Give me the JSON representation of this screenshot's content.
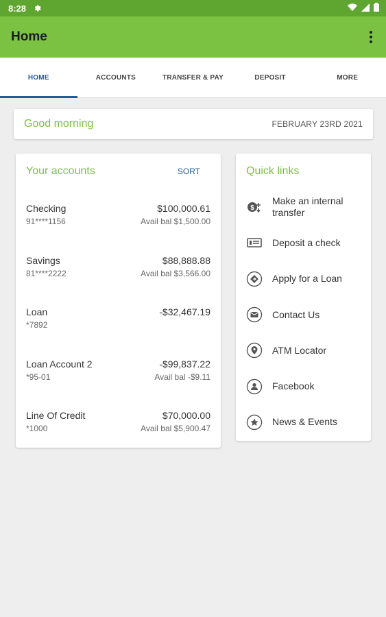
{
  "status": {
    "time": "8:28"
  },
  "appbar": {
    "title": "Home"
  },
  "tabs": [
    "HOME",
    "ACCOUNTS",
    "TRANSFER & PAY",
    "DEPOSIT",
    "MORE"
  ],
  "greeting": {
    "text": "Good morning",
    "date": "FEBRUARY 23RD 2021"
  },
  "accounts": {
    "title": "Your accounts",
    "sort_label": "SORT",
    "items": [
      {
        "name": "Checking",
        "number": "91****1156",
        "amount": "$100,000.61",
        "avail": "Avail bal $1,500.00"
      },
      {
        "name": "Savings",
        "number": "81****2222",
        "amount": "$88,888.88",
        "avail": "Avail bal $3,566.00"
      },
      {
        "name": "Loan",
        "number": "*7892",
        "amount": "-$32,467.19",
        "avail": ""
      },
      {
        "name": "Loan Account 2",
        "number": "*95-01",
        "amount": "-$99,837.22",
        "avail": "Avail bal -$9.11"
      },
      {
        "name": "Line Of Credit",
        "number": "*1000",
        "amount": "$70,000.00",
        "avail": "Avail bal $5,900.47"
      }
    ]
  },
  "quick_links": {
    "title": "Quick links",
    "items": [
      {
        "label": "Make an internal transfer",
        "icon": "transfer-icon"
      },
      {
        "label": "Deposit a check",
        "icon": "check-deposit-icon"
      },
      {
        "label": "Apply for a Loan",
        "icon": "loan-icon"
      },
      {
        "label": "Contact Us",
        "icon": "mail-icon"
      },
      {
        "label": "ATM Locator",
        "icon": "location-icon"
      },
      {
        "label": "Facebook",
        "icon": "person-icon"
      },
      {
        "label": "News & Events",
        "icon": "star-icon"
      }
    ]
  },
  "colors": {
    "status_bar": "#5fa630",
    "app_bar": "#7bc142",
    "accent_green": "#7bc142",
    "accent_blue": "#1f5a9a",
    "background": "#eeeeee"
  }
}
